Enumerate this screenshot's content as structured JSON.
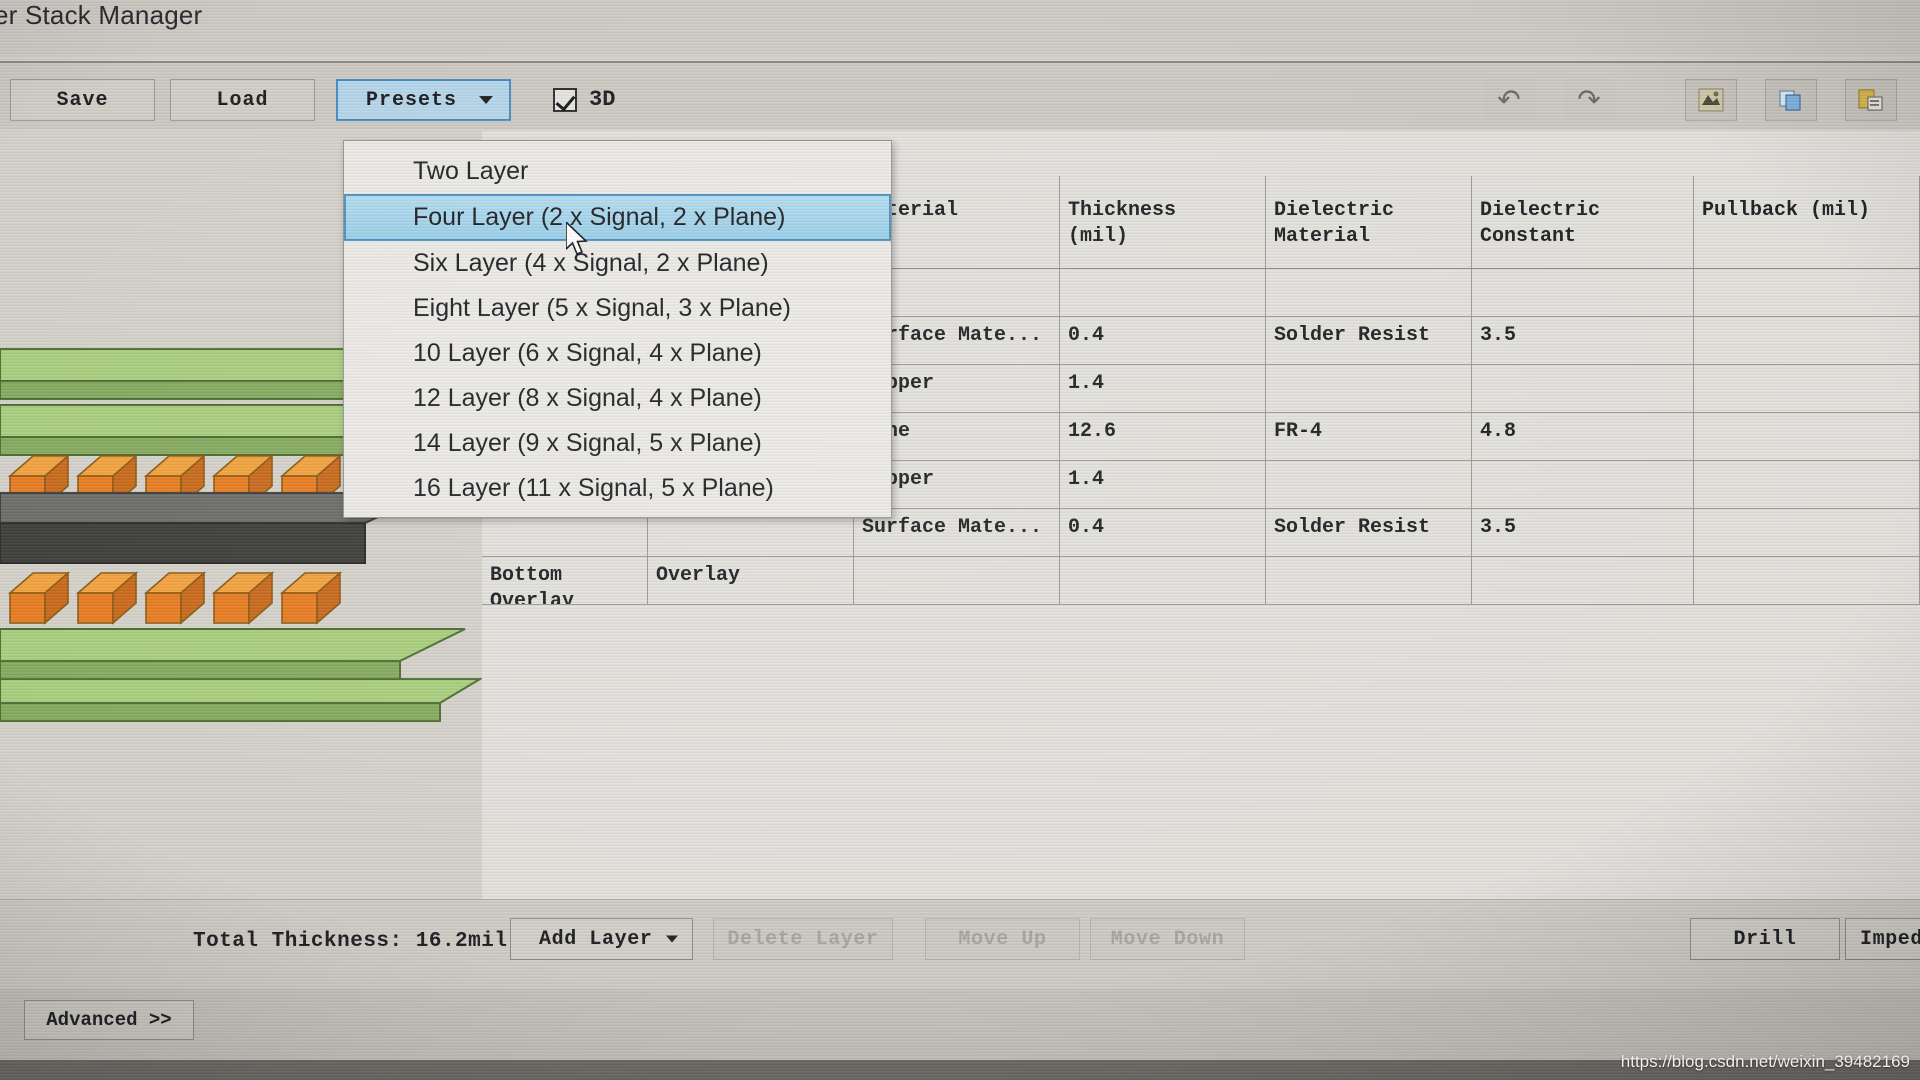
{
  "window": {
    "title": "er Stack Manager"
  },
  "toolbar": {
    "save_label": "Save",
    "load_label": "Load",
    "presets_label": "Presets",
    "presets_caret": "chevron-down-icon",
    "checkbox_3d_label": "3D",
    "checkbox_3d_checked": true,
    "undo_glyph": "↶",
    "redo_glyph": "↷",
    "icons": [
      "undo-icon",
      "redo-icon",
      "layer-properties-icon",
      "copy-layers-icon",
      "paste-layers-icon"
    ]
  },
  "presets_menu": {
    "open": true,
    "selected_index": 1,
    "items": [
      "Two Layer",
      "Four Layer (2 x Signal, 2 x Plane)",
      "Six Layer (4 x Signal, 2 x Plane)",
      "Eight Layer (5 x Signal, 3 x Plane)",
      "10 Layer (6 x Signal, 4 x Plane)",
      "12 Layer (8 x Signal, 4 x Plane)",
      "14 Layer (9 x Signal, 5 x Plane)",
      "16 Layer (11 x Signal, 5 x Plane)"
    ]
  },
  "table": {
    "headers": {
      "name": "",
      "type": "",
      "material": "Material",
      "thickness": "Thickness\n(mil)",
      "dielectric_material": "Dielectric\nMaterial",
      "dielectric_constant": "Dielectric\nConstant",
      "pullback": "Pullback (mil)"
    },
    "rows": [
      {
        "name": "",
        "type": "",
        "material": "",
        "thickness": "",
        "dielectric_material": "",
        "dielectric_constant": "",
        "pullback": ""
      },
      {
        "name": "",
        "type": "",
        "material": "Surface Mate...",
        "thickness": "0.4",
        "dielectric_material": "Solder Resist",
        "dielectric_constant": "3.5",
        "pullback": ""
      },
      {
        "name": "",
        "type": "",
        "material": "Copper",
        "thickness": "1.4",
        "dielectric_material": "",
        "dielectric_constant": "",
        "pullback": ""
      },
      {
        "name": "",
        "type": "",
        "material": "None",
        "thickness": "12.6",
        "dielectric_material": "FR-4",
        "dielectric_constant": "4.8",
        "pullback": ""
      },
      {
        "name": "",
        "type": "",
        "material": "Copper",
        "thickness": "1.4",
        "dielectric_material": "",
        "dielectric_constant": "",
        "pullback": ""
      },
      {
        "name": "",
        "type": "",
        "material": "Surface Mate...",
        "thickness": "0.4",
        "dielectric_material": "Solder Resist",
        "dielectric_constant": "3.5",
        "pullback": ""
      },
      {
        "name": "Bottom Overlay",
        "type": "Overlay",
        "material": "",
        "thickness": "",
        "dielectric_material": "",
        "dielectric_constant": "",
        "pullback": ""
      }
    ]
  },
  "bottom_bar": {
    "total_thickness": "Total Thickness: 16.2mil",
    "add_layer_label": "Add Layer",
    "add_layer_caret": "chevron-down-icon",
    "delete_layer_label": "Delete Layer",
    "delete_layer_enabled": false,
    "move_up_label": "Move Up",
    "move_up_enabled": false,
    "move_down_label": "Move Down",
    "move_down_enabled": false,
    "drill_label": "Drill",
    "impedance_label": "Impeda"
  },
  "footer": {
    "advanced_label": "Advanced >>"
  },
  "watermark": {
    "text": "https://blog.csdn.net/weixin_39482169"
  },
  "colors": {
    "accent": "#4a8cc0",
    "selection_fill": "#9bcfe8",
    "window_chrome": "#d6d2cb",
    "solder_mask_green": "#7aa84f",
    "copper_orange": "#e8922f"
  }
}
